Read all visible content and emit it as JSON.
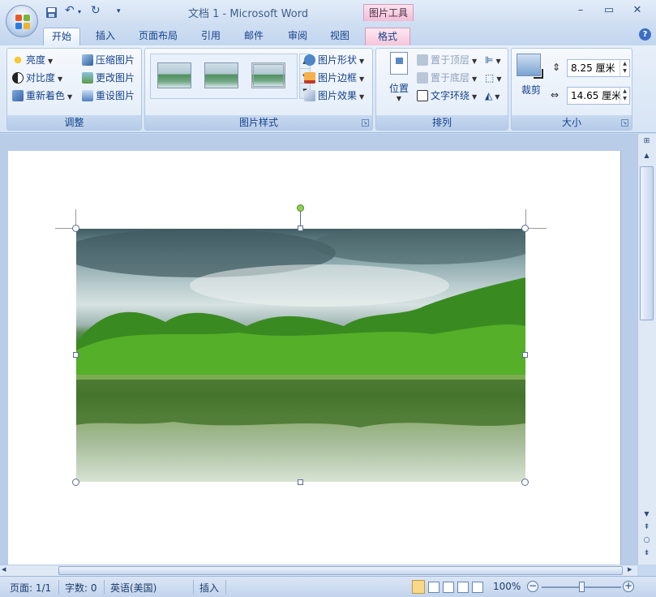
{
  "window": {
    "title": "文档 1 - Microsoft Word",
    "tool_context": "图片工具",
    "min": "–",
    "max": "▭",
    "close": "✕"
  },
  "qat": {
    "save": "save-icon",
    "undo": "↶",
    "redo": "↻",
    "customize": "▾"
  },
  "tabs": [
    {
      "label": "开始"
    },
    {
      "label": "插入"
    },
    {
      "label": "页面布局"
    },
    {
      "label": "引用"
    },
    {
      "label": "邮件"
    },
    {
      "label": "审阅"
    },
    {
      "label": "视图"
    },
    {
      "label": "格式"
    }
  ],
  "help": "?",
  "ribbon": {
    "adjust": {
      "label": "调整",
      "brightness": "亮度",
      "contrast": "对比度",
      "recolor": "重新着色",
      "compress": "压缩图片",
      "change": "更改图片",
      "reset": "重设图片"
    },
    "styles": {
      "label": "图片样式",
      "shape": "图片形状",
      "border": "图片边框",
      "effects": "图片效果"
    },
    "arrange": {
      "label": "排列",
      "position": "位置",
      "front": "置于顶层",
      "back": "置于底层",
      "wrap": "文字环绕"
    },
    "size": {
      "label": "大小",
      "crop": "裁剪",
      "height": "8.25 厘米",
      "width": "14.65 厘米"
    }
  },
  "status": {
    "page": "页面: 1/1",
    "words": "字数: 0",
    "language": "英语(美国)",
    "mode": "插入",
    "zoom": "100%",
    "zoom_level": 1.0
  },
  "colors": {
    "accent": "#15428b",
    "context_tab": "#f5c6db",
    "ribbon": "#dbe6f6"
  }
}
